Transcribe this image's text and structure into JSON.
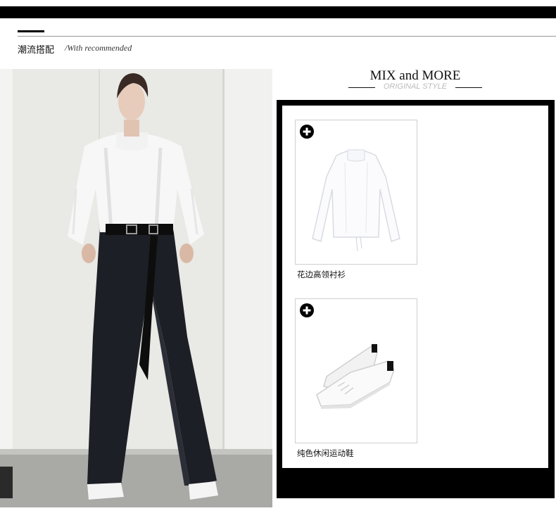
{
  "section": {
    "title_cn": "潮流搭配",
    "title_en": "/With recommended"
  },
  "mix": {
    "title": "MIX and MORE",
    "subtitle": "ORIGINAL STYLE"
  },
  "products": [
    {
      "name": "花边高领衬衫",
      "icon": "plus-circle-icon"
    },
    {
      "name": "纯色休闲运动鞋",
      "icon": "plus-circle-icon"
    }
  ],
  "colors": {
    "frame": "#000000",
    "accent_bar": "#000000",
    "subtitle": "#bbbbbb"
  }
}
